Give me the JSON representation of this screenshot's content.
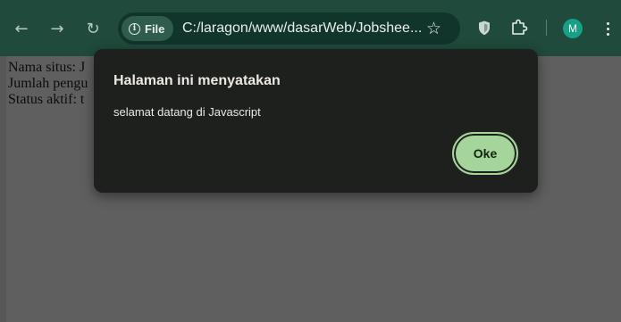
{
  "browser": {
    "nav": {
      "back_icon": "←",
      "forward_icon": "→",
      "reload_icon": "↻"
    },
    "address_bar": {
      "info_glyph": "i",
      "chip_label": "File",
      "url": "C:/laragon/www/dasarWeb/Jobshee...",
      "star_icon": "☆"
    },
    "profile": {
      "initial": "M",
      "color": "#16a085"
    },
    "colors": {
      "toolbar": "#1f4a3c",
      "omnibox": "#12352b"
    }
  },
  "page": {
    "lines": [
      "Nama situs: J",
      "Jumlah pengu",
      "Status aktif: t"
    ]
  },
  "dialog": {
    "title": "Halaman ini menyatakan",
    "message": "selamat datang di Javascript",
    "ok_label": "Oke",
    "colors": {
      "background": "#1d201d",
      "button": "#a5d59b"
    }
  }
}
